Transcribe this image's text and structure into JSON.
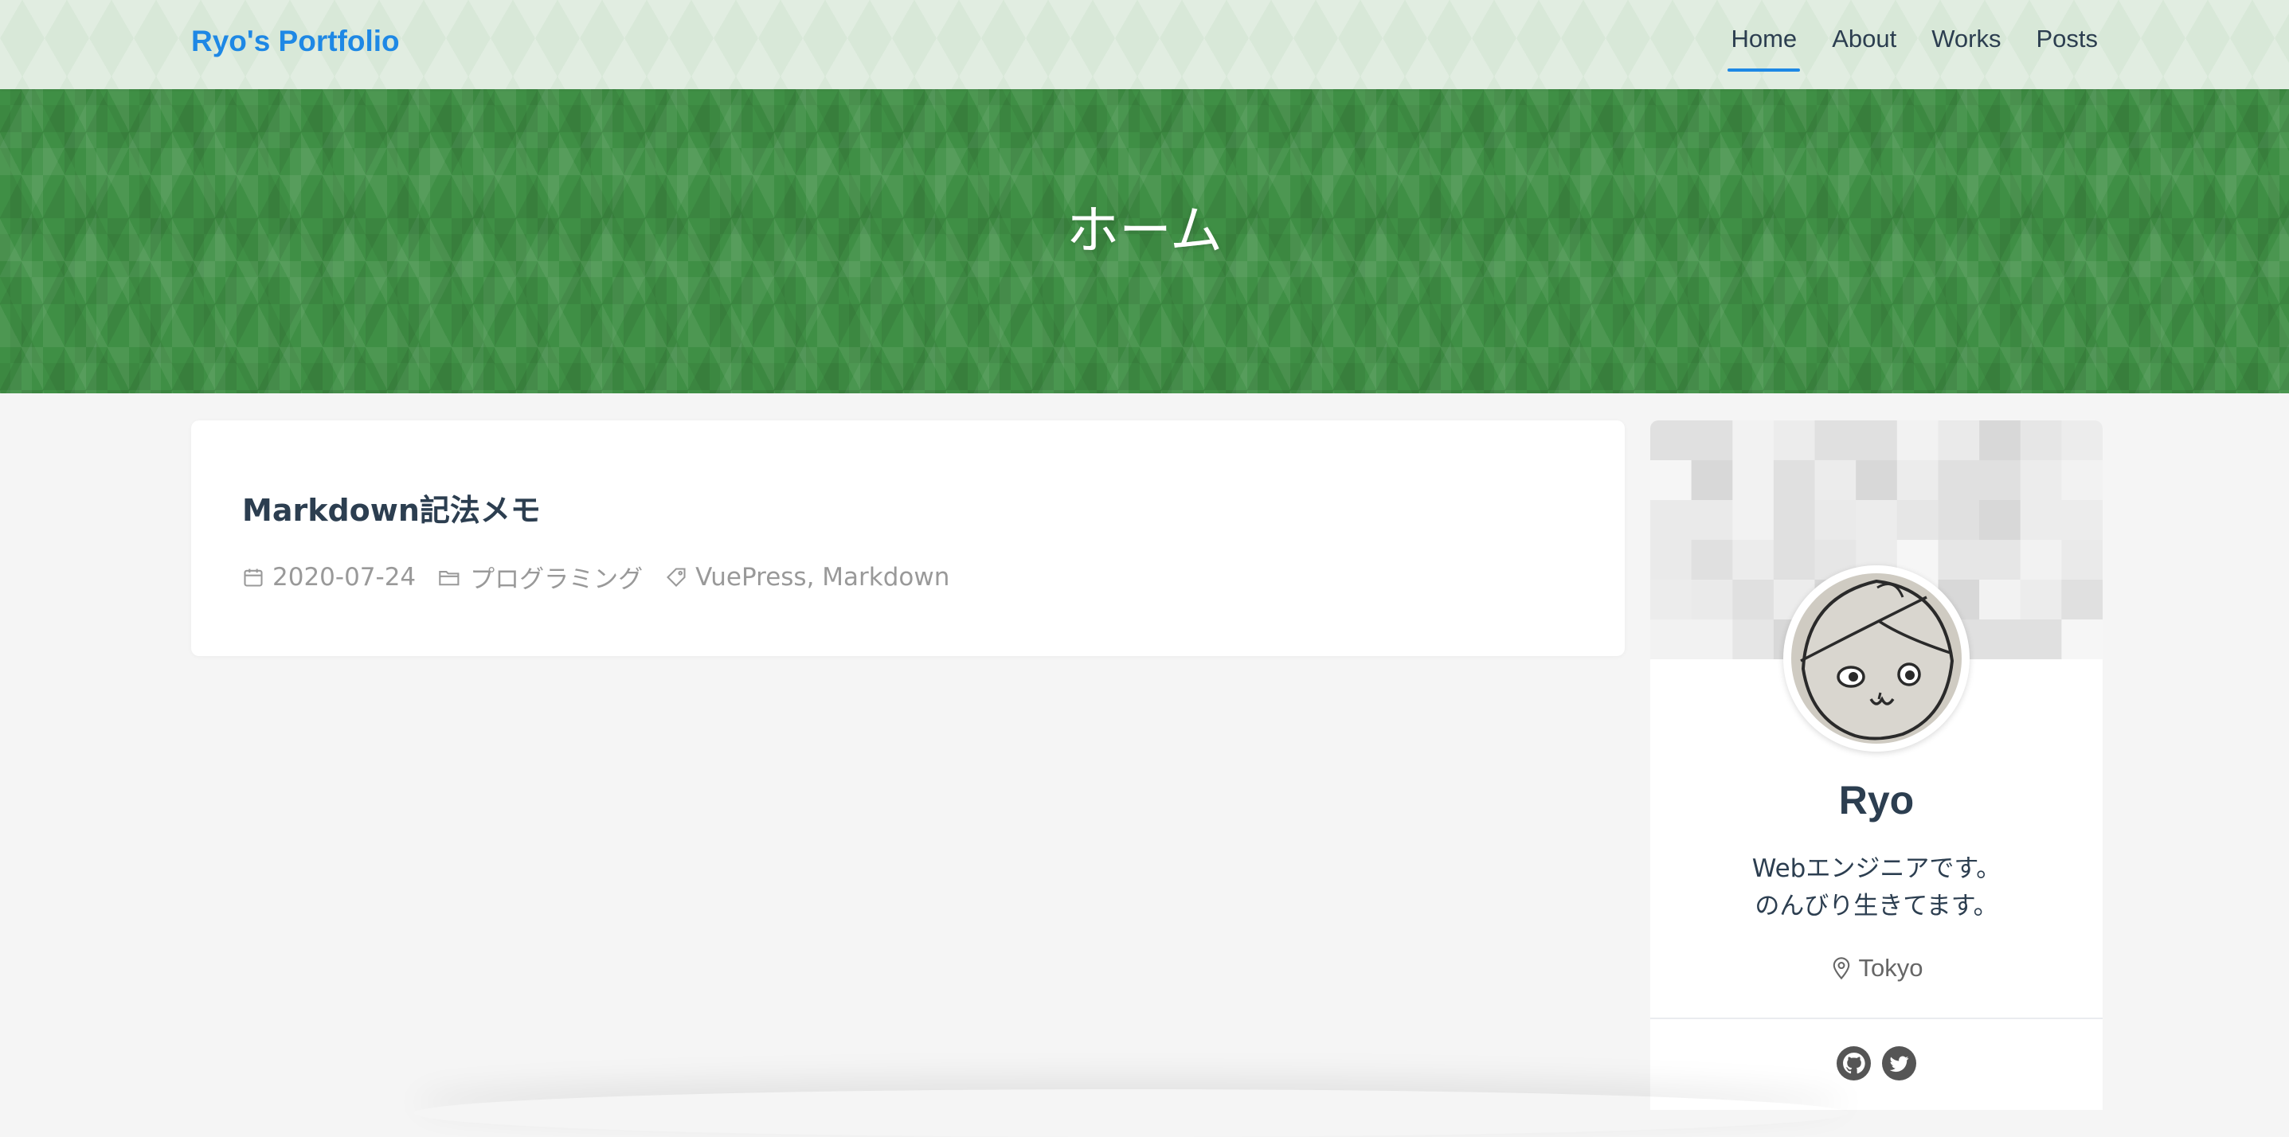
{
  "navbar": {
    "site_name": "Ryo's Portfolio",
    "links": [
      {
        "label": "Home",
        "active": true
      },
      {
        "label": "About",
        "active": false
      },
      {
        "label": "Works",
        "active": false
      },
      {
        "label": "Posts",
        "active": false
      }
    ]
  },
  "hero": {
    "title": "ホーム"
  },
  "posts": [
    {
      "title": "Markdown記法メモ",
      "date": "2020-07-24",
      "category": "プログラミング",
      "tags": "VuePress, Markdown"
    }
  ],
  "profile": {
    "name": "Ryo",
    "bio_line1": "Webエンジニアです。",
    "bio_line2": "のんびり生きてます。",
    "location": "Tokyo",
    "social": [
      "github-icon",
      "twitter-icon"
    ]
  },
  "colors": {
    "accent": "#1e88e5",
    "hero_green": "#3f8f45",
    "text": "#2c3e50",
    "meta": "#999999"
  }
}
